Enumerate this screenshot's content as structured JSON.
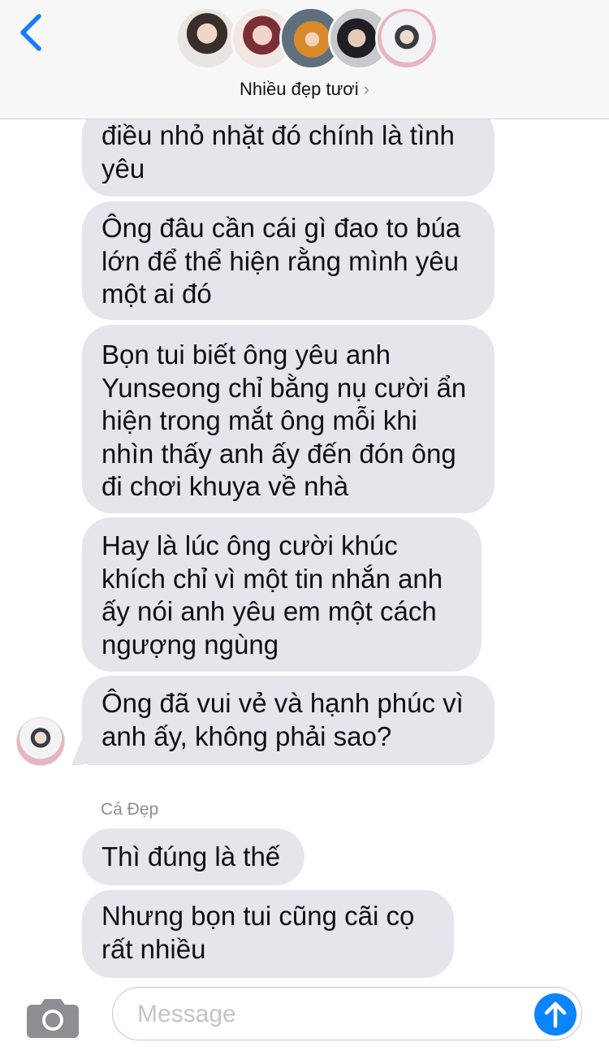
{
  "header": {
    "back_icon": "chevron-left-icon",
    "title": "Nhiều đẹp tươi",
    "title_chevron": "›",
    "accent_color": "#147efb",
    "avatars": [
      "member-avatar-1",
      "member-avatar-2",
      "member-avatar-3",
      "member-avatar-4",
      "member-avatar-5"
    ]
  },
  "messages": [
    {
      "text": "điều nhỏ nhặt đó chính là tình\nyêu"
    },
    {
      "text": "Ông đâu cần cái gì đao to búa\nlớn để thể hiện rằng mình yêu\nmột ai đó"
    },
    {
      "text": "Bọn tui biết ông yêu anh\nYunseong chỉ bằng nụ cười ẩn\nhiện trong mắt ông mỗi khi\nnhìn thấy anh ấy đến đón ông\nđi chơi khuya về nhà"
    },
    {
      "text": "Hay là lúc ông cười khúc\nkhích chỉ vì một tin nhắn anh\nấy nói anh yêu em một cách\nngượng ngùng"
    },
    {
      "text": "Ông đã vui vẻ và hạnh phúc vì\nanh ấy, không phải sao?"
    }
  ],
  "sender_label": "Cá Đẹp",
  "messages_2": [
    {
      "text": "Thì đúng là thế"
    },
    {
      "text": "Nhưng bọn tui cũng cãi cọ\nrất nhiều"
    }
  ],
  "bubble_color": "#e6e5eb",
  "composer": {
    "placeholder": "Message",
    "camera_icon": "camera-icon",
    "send_icon": "arrow-up-icon",
    "send_color": "#0a84ff"
  }
}
